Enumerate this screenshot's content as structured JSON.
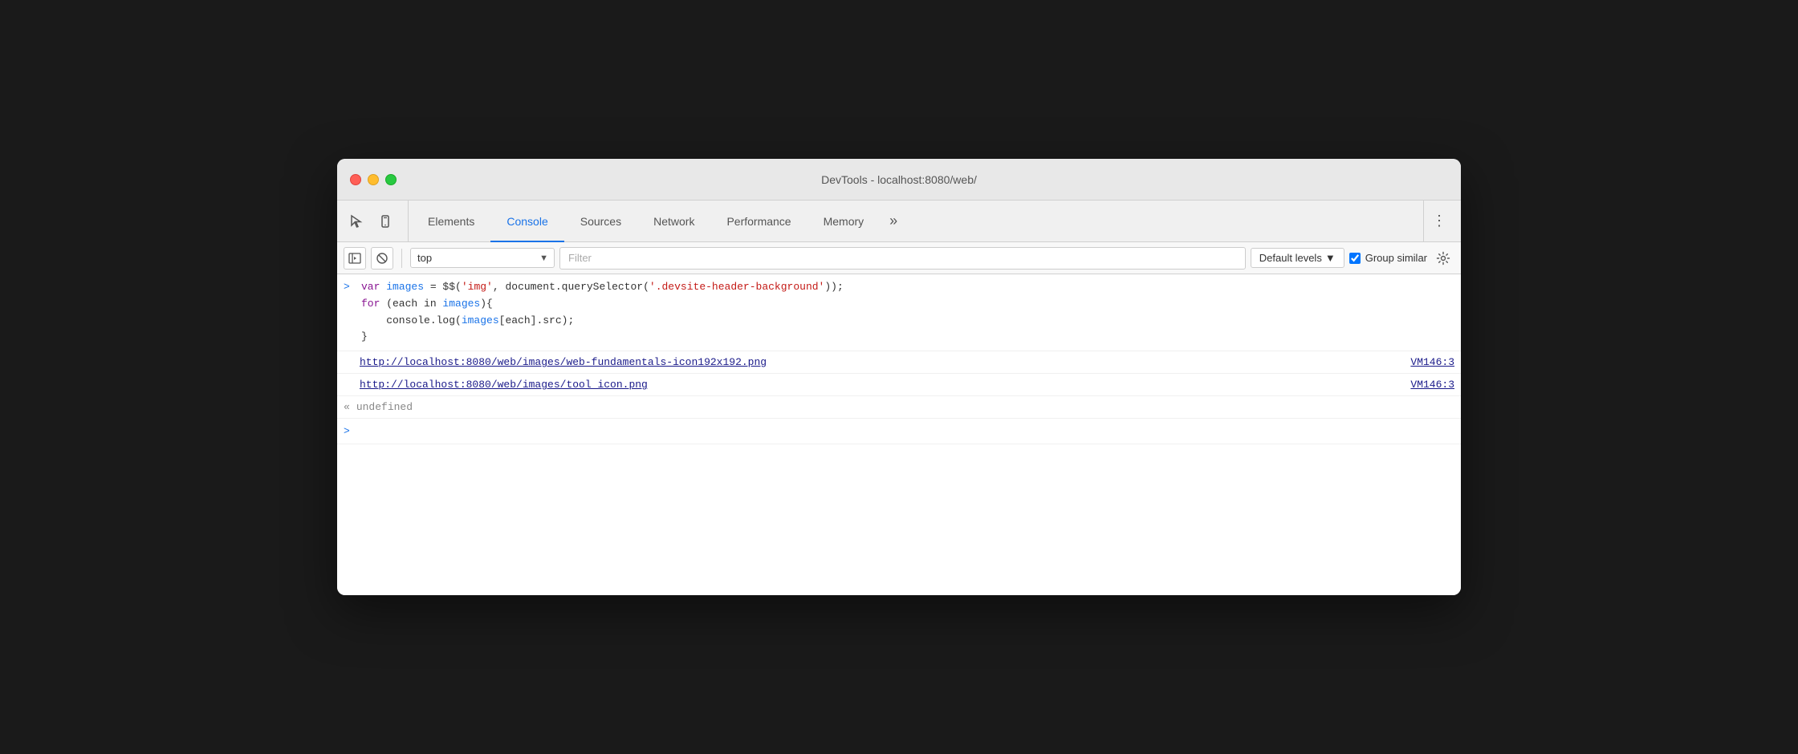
{
  "window": {
    "title": "DevTools - localhost:8080/web/"
  },
  "tabs": [
    {
      "id": "elements",
      "label": "Elements",
      "active": false
    },
    {
      "id": "console",
      "label": "Console",
      "active": true
    },
    {
      "id": "sources",
      "label": "Sources",
      "active": false
    },
    {
      "id": "network",
      "label": "Network",
      "active": false
    },
    {
      "id": "performance",
      "label": "Performance",
      "active": false
    },
    {
      "id": "memory",
      "label": "Memory",
      "active": false
    }
  ],
  "secondary_toolbar": {
    "context_options": [
      "top"
    ],
    "context_value": "top",
    "filter_placeholder": "Filter",
    "levels_label": "Default levels",
    "group_similar_label": "Group similar",
    "group_similar_checked": true
  },
  "console": {
    "entries": [
      {
        "type": "input",
        "arrow": ">",
        "code_lines": [
          "var images = $$('img', document.querySelector('.devsite-header-background'));",
          "for (each in images){",
          "    console.log(images[each].src);",
          "}"
        ]
      },
      {
        "type": "output-link",
        "link": "http://localhost:8080/web/images/web-fundamentals-icon192x192.png",
        "ref": "VM146:3"
      },
      {
        "type": "output-link",
        "link": "http://localhost:8080/web/images/tool_icon.png",
        "ref": "VM146:3"
      },
      {
        "type": "undefined",
        "arrow": "«",
        "value": "undefined"
      }
    ],
    "input_arrow": ">",
    "input_placeholder": ""
  }
}
